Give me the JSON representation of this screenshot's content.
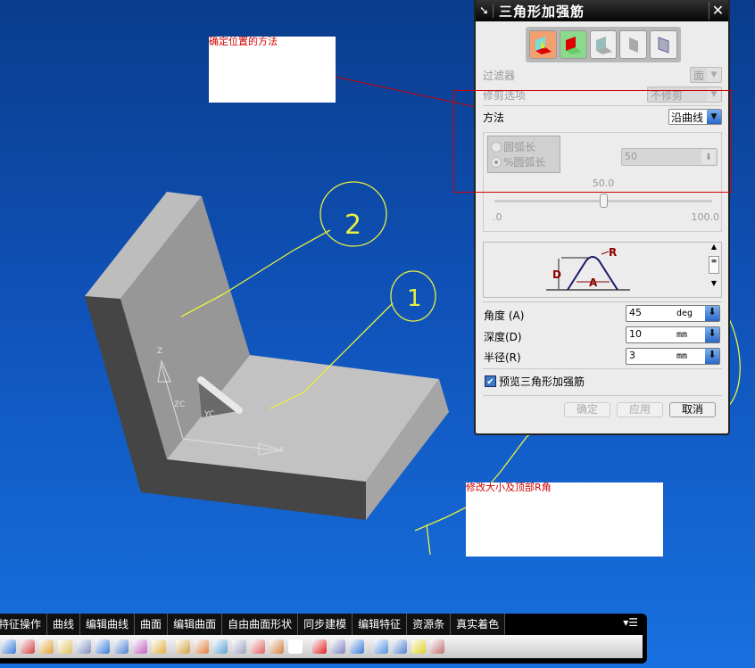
{
  "dialog": {
    "title": "三角形加强筋",
    "close_icon": "close-icon",
    "pin_icon": "pin-icon",
    "type_buttons": [
      "rib-type-1",
      "rib-type-2",
      "rib-type-3",
      "rib-type-4",
      "rib-type-5"
    ],
    "filter": {
      "label": "过滤器",
      "value": "面"
    },
    "trim": {
      "label": "修剪选项",
      "value": "不修剪"
    },
    "method": {
      "label": "方法",
      "value": "沿曲线"
    },
    "position": {
      "options": [
        "圆弧长",
        "%圆弧长"
      ],
      "selected": "%圆弧长",
      "value": "50",
      "slider_value": "50.0",
      "slider_min": ".0",
      "slider_max": "100.0",
      "slider_fraction": 0.5
    },
    "diagram": {
      "labels": [
        "R",
        "D",
        "A"
      ]
    },
    "angle": {
      "label": "角度 (A)",
      "value": "45",
      "unit": "deg"
    },
    "depth": {
      "label": "深度(D)",
      "value": "10",
      "unit": "mm"
    },
    "radius": {
      "label": "半径(R)",
      "value": "3",
      "unit": "mm"
    },
    "preview": {
      "label": "预览三角形加强筋",
      "checked": true
    },
    "buttons": {
      "ok": "确定",
      "apply": "应用",
      "cancel": "取消"
    }
  },
  "annotations": {
    "note1": "确定位置的方法",
    "note2": "修改大小及顶部R角",
    "circle1": "1",
    "circle2": "2"
  },
  "axes": {
    "z": "Z",
    "zc": "ZC",
    "yc": "YC",
    "x": "X"
  },
  "toolbar": {
    "tabs": [
      "特征操作",
      "曲线",
      "编辑曲线",
      "曲面",
      "编辑曲面",
      "自由曲面形状",
      "同步建模",
      "编辑特征",
      "资源条",
      "真实着色"
    ],
    "icon_colors": [
      "#3a7ad8",
      "#d04040",
      "#e0a030",
      "#e0c060",
      "#8090c0",
      "#3a7ad8",
      "#5080d0",
      "#c060c0",
      "#e0b040",
      "#d0a040",
      "#e08040",
      "#60a0d0",
      "#a0a0c0",
      "#e06060",
      "#d08040",
      "#ffffff",
      "#e02020",
      "#8080c0",
      "#3a7ad8",
      "#5090e0",
      "#5080d0",
      "#e0d020",
      "#c07070"
    ]
  },
  "colors": {
    "accent_red": "#d00000",
    "sketch_yellow": "#e8f040"
  }
}
